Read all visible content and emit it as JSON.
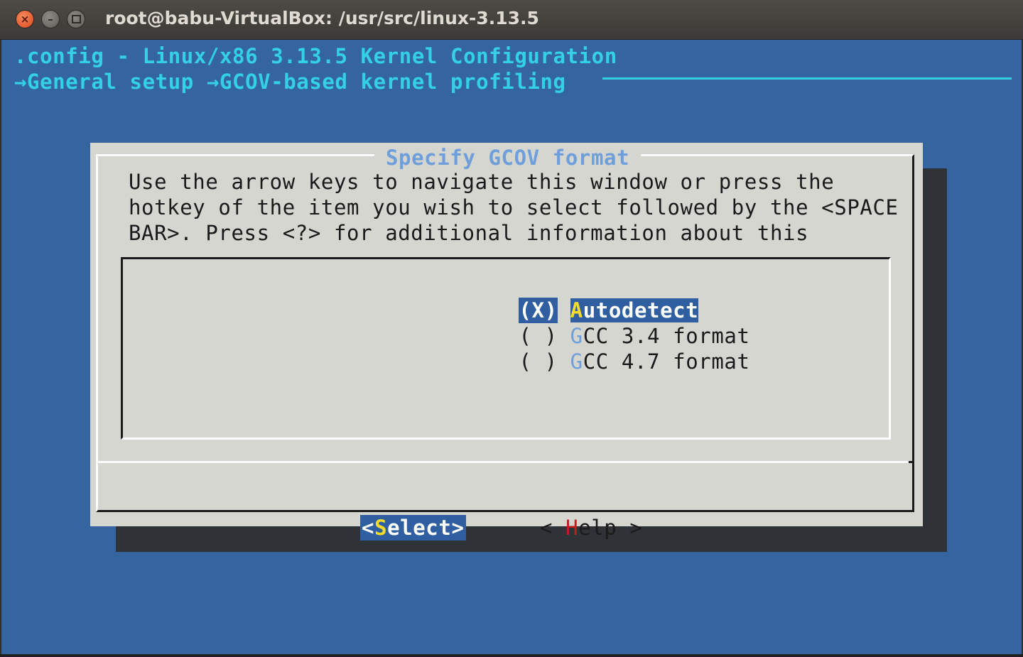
{
  "window": {
    "title": "root@babu-VirtualBox: /usr/src/linux-3.13.5",
    "close_label": "×",
    "minimize_label": "–"
  },
  "header": {
    "line1": ".config - Linux/x86 3.13.5 Kernel Configuration",
    "breadcrumb": "→General setup →GCOV-based kernel profiling"
  },
  "dialog": {
    "title": "Specify GCOV format",
    "instructions": [
      "Use the arrow keys to navigate this window or press the",
      "hotkey of the item you wish to select followed by the <SPACE",
      "BAR>. Press <?> for additional information about this"
    ],
    "options": [
      {
        "mark": "(X)",
        "hotkey": "A",
        "rest": "utodetect",
        "selected": true
      },
      {
        "mark": "( )",
        "hotkey": "G",
        "rest": "CC 3.4 format",
        "selected": false
      },
      {
        "mark": "( )",
        "hotkey": "G",
        "rest": "CC 4.7 format",
        "selected": false
      }
    ],
    "buttons": {
      "select": {
        "left": "<",
        "hotkey": "S",
        "rest": "elect",
        "right": ">"
      },
      "help": {
        "left": "< ",
        "hotkey": "H",
        "rest": "elp",
        "right": " >"
      }
    }
  },
  "colors": {
    "terminal_bg": "#3565a1",
    "header_text": "#34d1e4",
    "dialog_bg": "#d6d6d1",
    "highlight_bg": "#2f5fa0",
    "hotkey_selected": "#f5dc2b",
    "hotkey_normal": "#6e9fdb",
    "help_hotkey": "#c41c1c"
  }
}
